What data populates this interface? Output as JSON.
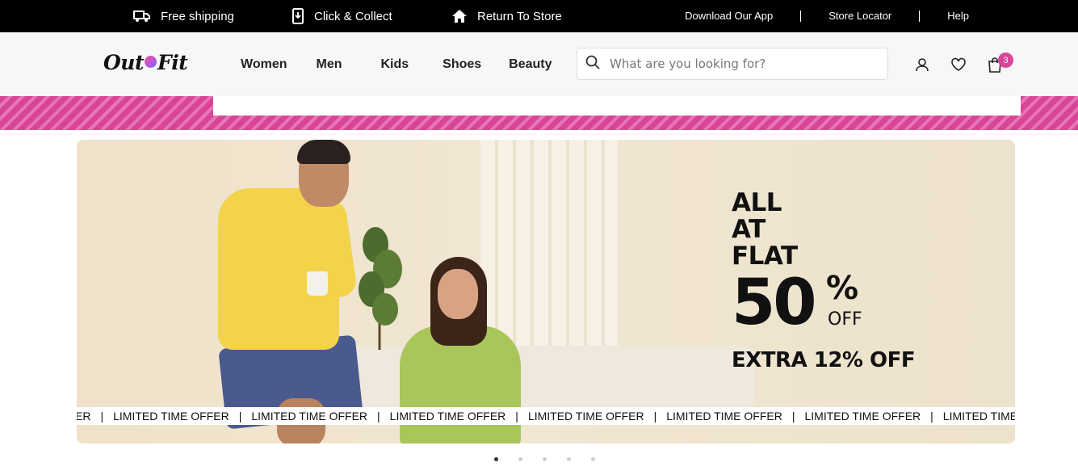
{
  "topbar": {
    "perks": [
      {
        "label": "Free shipping",
        "icon": "truck-icon"
      },
      {
        "label": "Click & Collect",
        "icon": "phone-download-icon"
      },
      {
        "label": "Return To Store",
        "icon": "home-icon"
      }
    ],
    "links": [
      "Download Our App",
      "Store Locator",
      "Help"
    ]
  },
  "header": {
    "logo": {
      "part1": "Out",
      "part2": "Fit"
    },
    "nav": [
      "Women",
      "Men",
      "Kids",
      "Shoes",
      "Beauty"
    ],
    "search": {
      "placeholder": "What are you looking for?",
      "value": ""
    },
    "icons": [
      "user-icon",
      "heart-icon",
      "shopping-bag-icon"
    ],
    "cart_count": "3"
  },
  "colors": {
    "topbar_bg": "#000000",
    "accent_pink": "#d9459b",
    "header_bg": "#f7f7f7"
  },
  "hero": {
    "offer_lines": [
      "ALL",
      "AT",
      "FLAT"
    ],
    "big_number": "50",
    "percent_sign": "%",
    "off_label": "OFF",
    "extra": "EXTRA 12% OFF",
    "ticker_items": [
      "ER",
      "LIMITED TIME OFFER",
      "LIMITED TIME OFFER",
      "LIMITED TIME OFFER",
      "LIMITED TIME OFFER",
      "LIMITED TIME OFFER",
      "LIMITED TIME OFFER",
      "LIMITED TIME OFFER"
    ],
    "ticker_separator": "|"
  },
  "carousel": {
    "slide_count": 5,
    "active_index": 0
  }
}
